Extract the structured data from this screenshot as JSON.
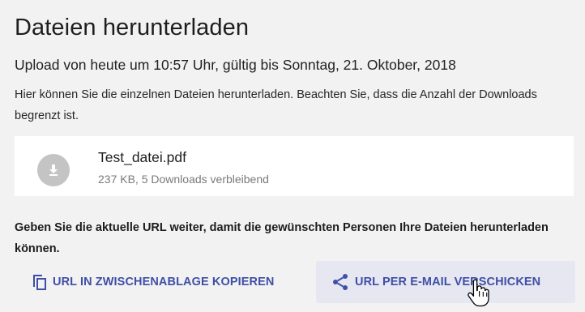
{
  "page": {
    "title": "Dateien herunterladen",
    "subtitle": "Upload von heute um 10:57 Uhr, gültig bis Sonntag, 21. Oktober, 2018",
    "description": "Hier können Sie die einzelnen Dateien herunterladen. Beachten Sie, dass die Anzahl der Downloads begrenzt ist."
  },
  "file": {
    "name": "Test_datei.pdf",
    "meta": "237 KB, 5 Downloads verbleibend",
    "icon": "download-icon"
  },
  "share": {
    "text": "Geben Sie die aktuelle URL weiter, damit die gewünschten Personen Ihre Dateien herunterladen können.",
    "copy_label": "URL IN ZWISCHENABLAGE KOPIEREN",
    "copy_icon": "copy-icon",
    "email_label": "URL PER E-MAIL VERSCHICKEN",
    "email_icon": "share-icon"
  },
  "colors": {
    "accent": "#3f4fa6",
    "background": "#f2f2f2",
    "button_hover": "#e6e7f1",
    "icon_gray": "#c4c4c4"
  }
}
